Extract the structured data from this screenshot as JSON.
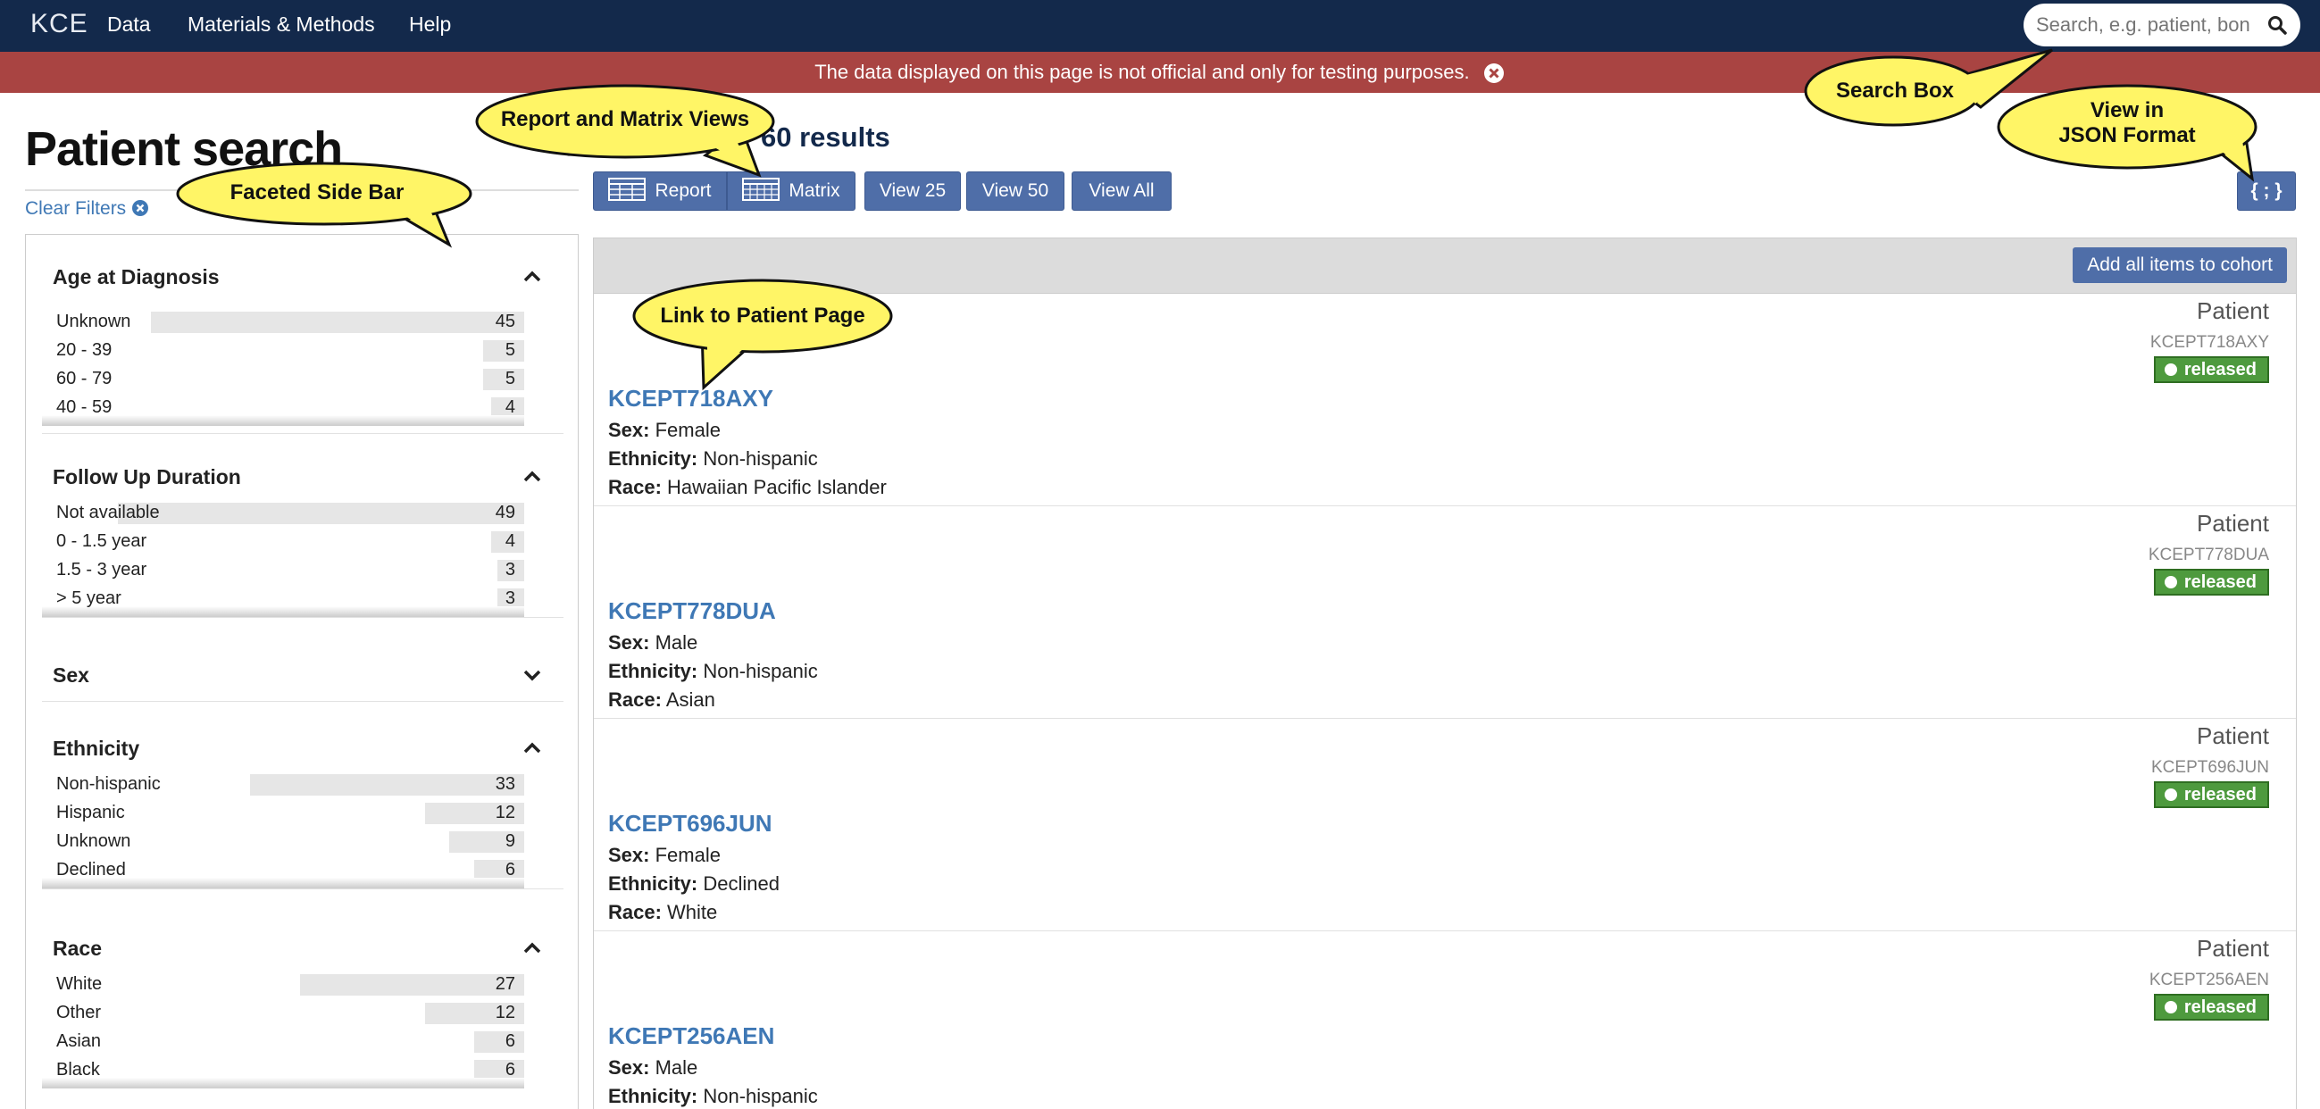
{
  "nav": {
    "brand": "KCE",
    "items": [
      "Data",
      "Materials & Methods",
      "Help"
    ],
    "search_placeholder": "Search, e.g. patient, bon"
  },
  "banner": {
    "text": "The data displayed on this page is not official and only for testing purposes."
  },
  "sidebar": {
    "title": "Patient search",
    "clear_filters": "Clear Filters",
    "facets": [
      {
        "title": "Age at Diagnosis",
        "expanded": true,
        "rows": [
          {
            "label": "Unknown",
            "count": "45",
            "value": 45
          },
          {
            "label": "20 - 39",
            "count": "5",
            "value": 5
          },
          {
            "label": "60 - 79",
            "count": "5",
            "value": 5
          },
          {
            "label": "40 - 59",
            "count": "4",
            "value": 4
          }
        ]
      },
      {
        "title": "Follow Up Duration",
        "expanded": true,
        "rows": [
          {
            "label": "Not available",
            "count": "49",
            "value": 49
          },
          {
            "label": "0 - 1.5 year",
            "count": "4",
            "value": 4
          },
          {
            "label": "1.5 - 3 year",
            "count": "3",
            "value": 3
          },
          {
            "label": "> 5 year",
            "count": "3",
            "value": 3
          }
        ]
      },
      {
        "title": "Sex",
        "expanded": false,
        "rows": []
      },
      {
        "title": "Ethnicity",
        "expanded": true,
        "rows": [
          {
            "label": "Non-hispanic",
            "count": "33",
            "value": 33
          },
          {
            "label": "Hispanic",
            "count": "12",
            "value": 12
          },
          {
            "label": "Unknown",
            "count": "9",
            "value": 9
          },
          {
            "label": "Declined",
            "count": "6",
            "value": 6
          }
        ]
      },
      {
        "title": "Race",
        "expanded": true,
        "rows": [
          {
            "label": "White",
            "count": "27",
            "value": 27
          },
          {
            "label": "Other",
            "count": "12",
            "value": 12
          },
          {
            "label": "Asian",
            "count": "6",
            "value": 6
          },
          {
            "label": "Black",
            "count": "6",
            "value": 6
          }
        ]
      }
    ]
  },
  "results": {
    "count_text": "60 results",
    "buttons": {
      "report": "Report",
      "matrix": "Matrix",
      "view25": "View 25",
      "view50": "View 50",
      "viewall": "View All",
      "json": "{ ; }"
    },
    "add_all": "Add all items to cohort",
    "labels": {
      "sex": "Sex:",
      "ethnicity": "Ethnicity:",
      "race": "Race:"
    },
    "items": [
      {
        "type": "Patient",
        "id": "KCEPT718AXY",
        "status": "released",
        "sex": "Female",
        "ethnicity": "Non-hispanic",
        "race": "Hawaiian Pacific Islander"
      },
      {
        "type": "Patient",
        "id": "KCEPT778DUA",
        "status": "released",
        "sex": "Male",
        "ethnicity": "Non-hispanic",
        "race": "Asian"
      },
      {
        "type": "Patient",
        "id": "KCEPT696JUN",
        "status": "released",
        "sex": "Female",
        "ethnicity": "Declined",
        "race": "White"
      },
      {
        "type": "Patient",
        "id": "KCEPT256AEN",
        "status": "released",
        "sex": "Male",
        "ethnicity": "Non-hispanic",
        "race": ""
      }
    ]
  },
  "callouts": {
    "report_matrix": "Report and Matrix Views",
    "faceted": "Faceted Side Bar",
    "search": "Search Box",
    "json_line1": "View in",
    "json_line2": "JSON Format",
    "patient_link": "Link to Patient Page"
  },
  "colors": {
    "nav": "#13294b",
    "banner": "#a94442",
    "button": "#4f6ea8",
    "link": "#3f78b5",
    "released": "#4e9a3e",
    "callout": "#fff566"
  }
}
